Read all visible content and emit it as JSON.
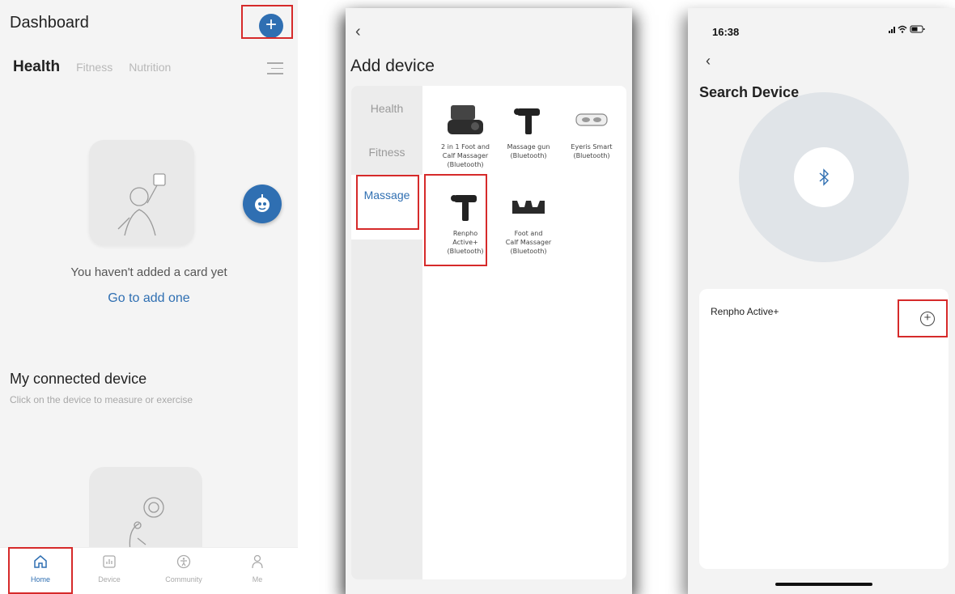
{
  "dashboard": {
    "title": "Dashboard",
    "add_icon": "plus-icon",
    "tabs": [
      {
        "label": "Health"
      },
      {
        "label": "Fitness"
      },
      {
        "label": "Nutrition"
      }
    ],
    "empty_text": "You haven't added a card yet",
    "add_link": "Go to add one",
    "connected_title": "My connected device",
    "connected_subtitle": "Click on the device to measure or exercise",
    "tabbar": [
      {
        "label": "Home",
        "icon": "home-icon"
      },
      {
        "label": "Device",
        "icon": "chart-icon"
      },
      {
        "label": "Community",
        "icon": "person-icon"
      },
      {
        "label": "Me",
        "icon": "user-icon"
      }
    ],
    "accent": "#2f6fb2"
  },
  "add_device": {
    "title": "Add device",
    "categories": [
      "Health",
      "Fitness",
      "Massage"
    ],
    "devices": [
      {
        "label": "2 in 1 Foot and\nCalf Massager\n(Bluetooth)"
      },
      {
        "label": "Massage gun\n(Bluetooth)"
      },
      {
        "label": "Eyeris Smart\n(Bluetooth)"
      },
      {
        "label": "Renpho\nActive+\n(Bluetooth)"
      },
      {
        "label": "Foot and\nCalf Massager\n(Bluetooth)"
      }
    ]
  },
  "search_device": {
    "time": "16:38",
    "title": "Search Device",
    "bluetooth_icon": "bluetooth-icon",
    "result_name": "Renpho Active+"
  },
  "highlight_color": "#d62a2a"
}
